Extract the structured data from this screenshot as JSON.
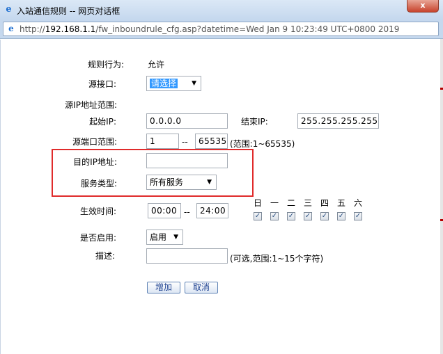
{
  "window": {
    "title": "入站通信规则 -- 网页对话框",
    "close_label": "x",
    "url_prefix": "http://",
    "url_host": "192.168.1.1",
    "url_path": "/fw_inboundrule_cfg.asp?datetime=Wed Jan 9 10:23:49 UTC+0800 2019"
  },
  "form": {
    "rule_action": {
      "label": "规则行为:",
      "value": "允许"
    },
    "source_interface": {
      "label": "源接口:",
      "value": "请选择"
    },
    "source_ip_range": {
      "label": "源IP地址范围:"
    },
    "start_ip": {
      "label": "起始IP:",
      "value": "0.0.0.0"
    },
    "end_ip": {
      "label": "结束IP:",
      "value": "255.255.255.255"
    },
    "source_port_range": {
      "label": "源端口范围:",
      "start": "1",
      "dash": "--",
      "end": "65535",
      "hint": "(范围:1~65535)"
    },
    "dest_ip": {
      "label": "目的IP地址:",
      "value": ""
    },
    "service_type": {
      "label": "服务类型:",
      "value": "所有服务"
    },
    "effective_time": {
      "label": "生效时间:",
      "start": "00:00",
      "dash": "--",
      "end": "24:00"
    },
    "days": [
      {
        "label": "日",
        "checked": true
      },
      {
        "label": "一",
        "checked": true
      },
      {
        "label": "二",
        "checked": true
      },
      {
        "label": "三",
        "checked": true
      },
      {
        "label": "四",
        "checked": true
      },
      {
        "label": "五",
        "checked": true
      },
      {
        "label": "六",
        "checked": true
      }
    ],
    "enabled": {
      "label": "是否启用:",
      "value": "启用"
    },
    "description": {
      "label": "描述:",
      "value": "",
      "hint": "(可选,范围:1~15个字符)"
    }
  },
  "buttons": {
    "add": "增加",
    "cancel": "取消"
  },
  "colors": {
    "highlight_border": "#e02b2b",
    "selected_bg": "#3399ff"
  }
}
